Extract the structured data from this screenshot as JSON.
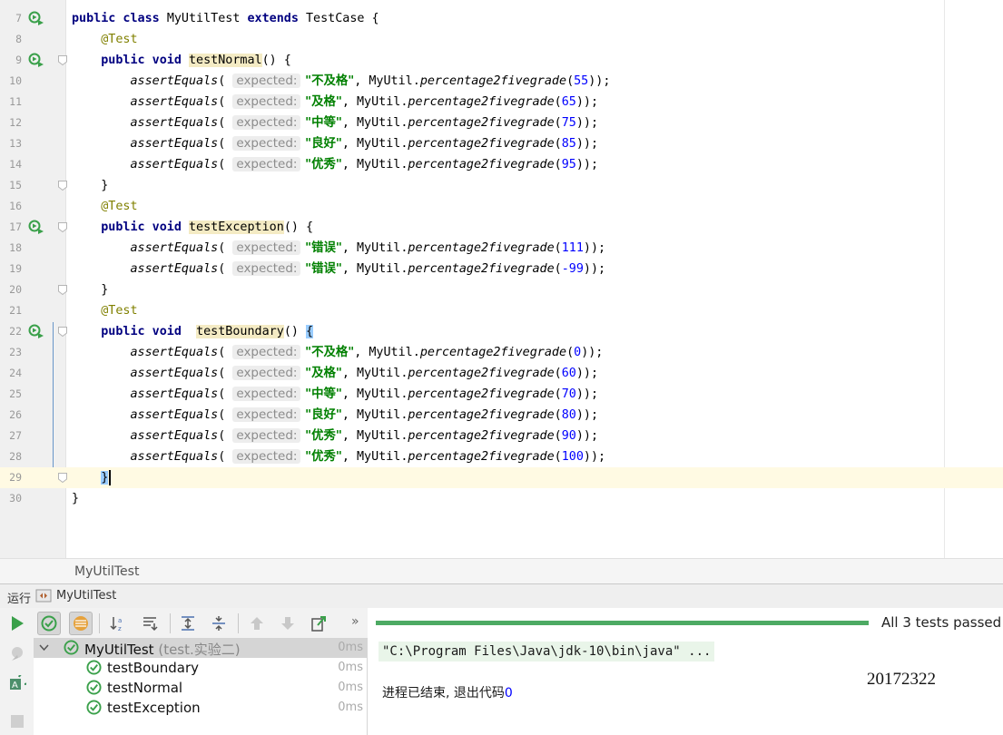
{
  "editor": {
    "lines": [
      {
        "n": "7",
        "icon": true,
        "fold": false,
        "current": false,
        "parts": [
          [
            "kw",
            "public class "
          ],
          [
            "",
            "MyUtilTest "
          ],
          [
            "kw",
            "extends "
          ],
          [
            "",
            "TestCase {"
          ]
        ]
      },
      {
        "n": "8",
        "icon": false,
        "fold": false,
        "current": false,
        "parts": [
          [
            "",
            "    "
          ],
          [
            "ann",
            "@Test"
          ]
        ]
      },
      {
        "n": "9",
        "icon": true,
        "fold": true,
        "current": false,
        "parts": [
          [
            "",
            "    "
          ],
          [
            "kw",
            "public void "
          ],
          [
            "hl",
            "testNormal"
          ],
          [
            "",
            "() {"
          ]
        ]
      },
      {
        "n": "10",
        "icon": false,
        "fold": false,
        "current": false,
        "parts": [
          [
            "",
            "        "
          ],
          [
            "it",
            "assertEquals"
          ],
          [
            "",
            "( "
          ],
          [
            "hint",
            "expected:"
          ],
          [
            "str",
            " \"不及格\""
          ],
          [
            "",
            ", MyUtil."
          ],
          [
            "st",
            "percentage2fivegrade"
          ],
          [
            "",
            "("
          ],
          [
            "num",
            "55"
          ],
          [
            "",
            "));"
          ]
        ]
      },
      {
        "n": "11",
        "icon": false,
        "fold": false,
        "current": false,
        "parts": [
          [
            "",
            "        "
          ],
          [
            "it",
            "assertEquals"
          ],
          [
            "",
            "( "
          ],
          [
            "hint",
            "expected:"
          ],
          [
            "str",
            " \"及格\""
          ],
          [
            "",
            ", MyUtil."
          ],
          [
            "st",
            "percentage2fivegrade"
          ],
          [
            "",
            "("
          ],
          [
            "num",
            "65"
          ],
          [
            "",
            "));"
          ]
        ]
      },
      {
        "n": "12",
        "icon": false,
        "fold": false,
        "current": false,
        "parts": [
          [
            "",
            "        "
          ],
          [
            "it",
            "assertEquals"
          ],
          [
            "",
            "( "
          ],
          [
            "hint",
            "expected:"
          ],
          [
            "str",
            " \"中等\""
          ],
          [
            "",
            ", MyUtil."
          ],
          [
            "st",
            "percentage2fivegrade"
          ],
          [
            "",
            "("
          ],
          [
            "num",
            "75"
          ],
          [
            "",
            "));"
          ]
        ]
      },
      {
        "n": "13",
        "icon": false,
        "fold": false,
        "current": false,
        "parts": [
          [
            "",
            "        "
          ],
          [
            "it",
            "assertEquals"
          ],
          [
            "",
            "( "
          ],
          [
            "hint",
            "expected:"
          ],
          [
            "str",
            " \"良好\""
          ],
          [
            "",
            ", MyUtil."
          ],
          [
            "st",
            "percentage2fivegrade"
          ],
          [
            "",
            "("
          ],
          [
            "num",
            "85"
          ],
          [
            "",
            "));"
          ]
        ]
      },
      {
        "n": "14",
        "icon": false,
        "fold": false,
        "current": false,
        "parts": [
          [
            "",
            "        "
          ],
          [
            "it",
            "assertEquals"
          ],
          [
            "",
            "( "
          ],
          [
            "hint",
            "expected:"
          ],
          [
            "str",
            " \"优秀\""
          ],
          [
            "",
            ", MyUtil."
          ],
          [
            "st",
            "percentage2fivegrade"
          ],
          [
            "",
            "("
          ],
          [
            "num",
            "95"
          ],
          [
            "",
            "));"
          ]
        ]
      },
      {
        "n": "15",
        "icon": false,
        "fold": true,
        "current": false,
        "parts": [
          [
            "",
            "    }"
          ]
        ]
      },
      {
        "n": "16",
        "icon": false,
        "fold": false,
        "current": false,
        "parts": [
          [
            "",
            "    "
          ],
          [
            "ann",
            "@Test"
          ]
        ]
      },
      {
        "n": "17",
        "icon": true,
        "fold": true,
        "current": false,
        "parts": [
          [
            "",
            "    "
          ],
          [
            "kw",
            "public void "
          ],
          [
            "hl",
            "testException"
          ],
          [
            "",
            "() {"
          ]
        ]
      },
      {
        "n": "18",
        "icon": false,
        "fold": false,
        "current": false,
        "parts": [
          [
            "",
            "        "
          ],
          [
            "it",
            "assertEquals"
          ],
          [
            "",
            "( "
          ],
          [
            "hint",
            "expected:"
          ],
          [
            "str",
            " \"错误\""
          ],
          [
            "",
            ", MyUtil."
          ],
          [
            "st",
            "percentage2fivegrade"
          ],
          [
            "",
            "("
          ],
          [
            "num",
            "111"
          ],
          [
            "",
            "));"
          ]
        ]
      },
      {
        "n": "19",
        "icon": false,
        "fold": false,
        "current": false,
        "parts": [
          [
            "",
            "        "
          ],
          [
            "it",
            "assertEquals"
          ],
          [
            "",
            "( "
          ],
          [
            "hint",
            "expected:"
          ],
          [
            "str",
            " \"错误\""
          ],
          [
            "",
            ", MyUtil."
          ],
          [
            "st",
            "percentage2fivegrade"
          ],
          [
            "",
            "("
          ],
          [
            "num",
            "-99"
          ],
          [
            "",
            "));"
          ]
        ]
      },
      {
        "n": "20",
        "icon": false,
        "fold": true,
        "current": false,
        "parts": [
          [
            "",
            "    }"
          ]
        ]
      },
      {
        "n": "21",
        "icon": false,
        "fold": false,
        "current": false,
        "parts": [
          [
            "",
            "    "
          ],
          [
            "ann",
            "@Test"
          ]
        ]
      },
      {
        "n": "22",
        "icon": true,
        "fold": true,
        "current": false,
        "parts": [
          [
            "",
            "    "
          ],
          [
            "kw",
            "public void  "
          ],
          [
            "hl",
            "testBoundary"
          ],
          [
            "",
            "() "
          ],
          [
            "bracehl",
            "{"
          ]
        ]
      },
      {
        "n": "23",
        "icon": false,
        "fold": false,
        "current": false,
        "parts": [
          [
            "",
            "        "
          ],
          [
            "it",
            "assertEquals"
          ],
          [
            "",
            "( "
          ],
          [
            "hint",
            "expected:"
          ],
          [
            "str",
            " \"不及格\""
          ],
          [
            "",
            ", MyUtil."
          ],
          [
            "st",
            "percentage2fivegrade"
          ],
          [
            "",
            "("
          ],
          [
            "num",
            "0"
          ],
          [
            "",
            "));"
          ]
        ]
      },
      {
        "n": "24",
        "icon": false,
        "fold": false,
        "current": false,
        "parts": [
          [
            "",
            "        "
          ],
          [
            "it",
            "assertEquals"
          ],
          [
            "",
            "( "
          ],
          [
            "hint",
            "expected:"
          ],
          [
            "str",
            " \"及格\""
          ],
          [
            "",
            ", MyUtil."
          ],
          [
            "st",
            "percentage2fivegrade"
          ],
          [
            "",
            "("
          ],
          [
            "num",
            "60"
          ],
          [
            "",
            "));"
          ]
        ]
      },
      {
        "n": "25",
        "icon": false,
        "fold": false,
        "current": false,
        "parts": [
          [
            "",
            "        "
          ],
          [
            "it",
            "assertEquals"
          ],
          [
            "",
            "( "
          ],
          [
            "hint",
            "expected:"
          ],
          [
            "str",
            " \"中等\""
          ],
          [
            "",
            ", MyUtil."
          ],
          [
            "st",
            "percentage2fivegrade"
          ],
          [
            "",
            "("
          ],
          [
            "num",
            "70"
          ],
          [
            "",
            "));"
          ]
        ]
      },
      {
        "n": "26",
        "icon": false,
        "fold": false,
        "current": false,
        "parts": [
          [
            "",
            "        "
          ],
          [
            "it",
            "assertEquals"
          ],
          [
            "",
            "( "
          ],
          [
            "hint",
            "expected:"
          ],
          [
            "str",
            " \"良好\""
          ],
          [
            "",
            ", MyUtil."
          ],
          [
            "st",
            "percentage2fivegrade"
          ],
          [
            "",
            "("
          ],
          [
            "num",
            "80"
          ],
          [
            "",
            "));"
          ]
        ]
      },
      {
        "n": "27",
        "icon": false,
        "fold": false,
        "current": false,
        "parts": [
          [
            "",
            "        "
          ],
          [
            "it",
            "assertEquals"
          ],
          [
            "",
            "( "
          ],
          [
            "hint",
            "expected:"
          ],
          [
            "str",
            " \"优秀\""
          ],
          [
            "",
            ", MyUtil."
          ],
          [
            "st",
            "percentage2fivegrade"
          ],
          [
            "",
            "("
          ],
          [
            "num",
            "90"
          ],
          [
            "",
            "));"
          ]
        ]
      },
      {
        "n": "28",
        "icon": false,
        "fold": false,
        "current": false,
        "parts": [
          [
            "",
            "        "
          ],
          [
            "it",
            "assertEquals"
          ],
          [
            "",
            "( "
          ],
          [
            "hint",
            "expected:"
          ],
          [
            "str",
            " \"优秀\""
          ],
          [
            "",
            ", MyUtil."
          ],
          [
            "st",
            "percentage2fivegrade"
          ],
          [
            "",
            "("
          ],
          [
            "num",
            "100"
          ],
          [
            "",
            "));"
          ]
        ]
      },
      {
        "n": "29",
        "icon": false,
        "fold": true,
        "current": true,
        "parts": [
          [
            "",
            "    "
          ],
          [
            "bracehl",
            "}"
          ],
          [
            "caret",
            ""
          ]
        ]
      },
      {
        "n": "30",
        "icon": false,
        "fold": false,
        "current": false,
        "parts": [
          [
            "",
            "}"
          ]
        ]
      }
    ]
  },
  "breadcrumb": {
    "label": "MyUtilTest"
  },
  "run": {
    "header_label": "运行",
    "tab_name": "MyUtilTest",
    "status": "All 3 tests passed -",
    "progress": 1.0,
    "tree": {
      "root": {
        "name": "MyUtilTest",
        "sub": "(test.实验二)",
        "time": "0ms"
      },
      "children": [
        {
          "name": "testBoundary",
          "time": "0ms"
        },
        {
          "name": "testNormal",
          "time": "0ms"
        },
        {
          "name": "testException",
          "time": "0ms"
        }
      ]
    },
    "console": {
      "command": "\"C:\\Program Files\\Java\\jdk-10\\bin\\java\" ...",
      "exit_text": "进程已结束, 退出代码",
      "exit_code": "0",
      "student_id": "20172322"
    }
  },
  "colors": {
    "accent": "#4daa63",
    "keyword": "#000080",
    "string": "#008000",
    "number": "#0000ff",
    "annotation": "#808000"
  }
}
